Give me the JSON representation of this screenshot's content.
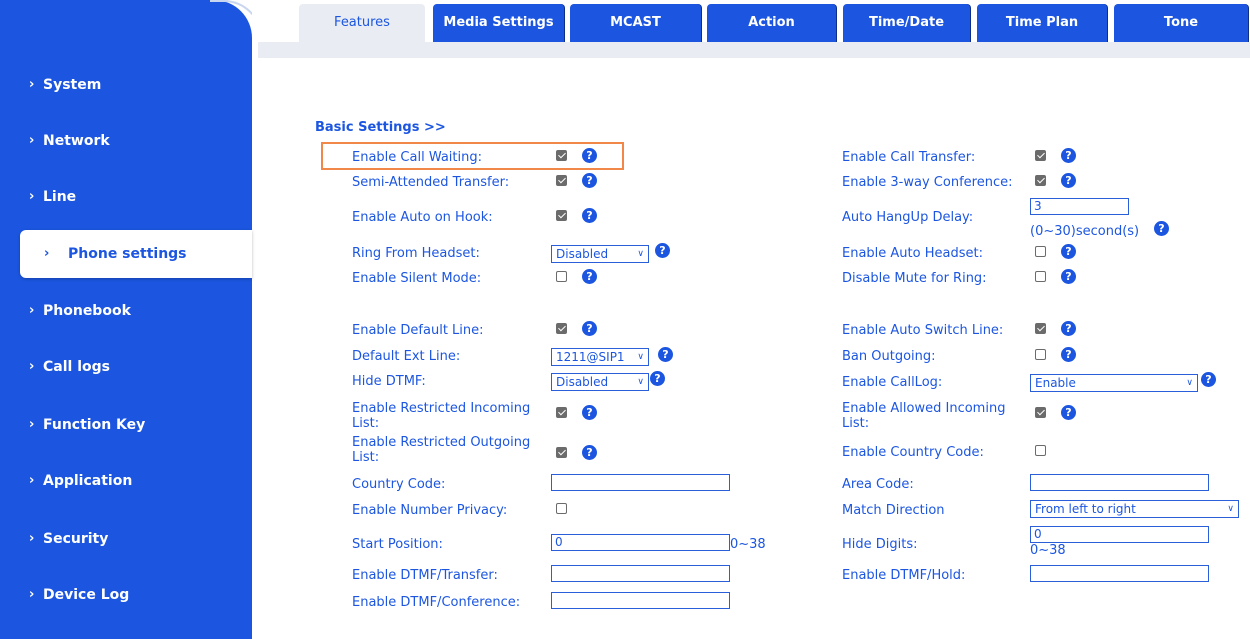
{
  "tabs": [
    {
      "label": "Features"
    },
    {
      "label": "Media Settings"
    },
    {
      "label": "MCAST"
    },
    {
      "label": "Action"
    },
    {
      "label": "Time/Date"
    },
    {
      "label": "Time Plan"
    },
    {
      "label": "Tone"
    }
  ],
  "sidebar": {
    "chevron": "›",
    "items": [
      {
        "label": "System"
      },
      {
        "label": "Network"
      },
      {
        "label": "Line"
      },
      {
        "label": "Phone settings"
      },
      {
        "label": "Phonebook"
      },
      {
        "label": "Call logs"
      },
      {
        "label": "Function Key"
      },
      {
        "label": "Application"
      },
      {
        "label": "Security"
      },
      {
        "label": "Device Log"
      }
    ]
  },
  "section": {
    "title": "Basic Settings >>"
  },
  "help_glyph": "?",
  "arrow_glyph": "∨",
  "left": {
    "call_waiting": {
      "label": "Enable Call Waiting:",
      "checked": true
    },
    "semi_transfer": {
      "label": "Semi-Attended Transfer:",
      "checked": true
    },
    "auto_on_hook": {
      "label": "Enable Auto on Hook:",
      "checked": true
    },
    "ring_headset": {
      "label": "Ring From Headset:",
      "value": "Disabled"
    },
    "silent_mode": {
      "label": "Enable Silent Mode:",
      "checked": false
    },
    "default_line": {
      "label": "Enable Default Line:",
      "checked": true
    },
    "default_ext": {
      "label": "Default Ext Line:",
      "value": "1211@SIP1"
    },
    "hide_dtmf": {
      "label": "Hide DTMF:",
      "value": "Disabled"
    },
    "restricted_in": {
      "label_line1": "Enable Restricted Incoming",
      "label_line2": "List:",
      "checked": true
    },
    "restricted_out": {
      "label_line1": "Enable Restricted Outgoing",
      "label_line2": "List:",
      "checked": true
    },
    "country_code": {
      "label": "Country Code:",
      "value": ""
    },
    "number_privacy": {
      "label": "Enable Number Privacy:",
      "checked": false
    },
    "start_position": {
      "label": "Start Position:",
      "value": "0",
      "range": "0~38"
    },
    "dtmf_transfer": {
      "label": "Enable DTMF/Transfer:",
      "value": ""
    },
    "dtmf_conference": {
      "label": "Enable DTMF/Conference:",
      "value": ""
    }
  },
  "right": {
    "call_transfer": {
      "label": "Enable Call Transfer:",
      "checked": true
    },
    "three_way": {
      "label": "Enable 3-way Conference:",
      "checked": true
    },
    "hangup_delay": {
      "label": "Auto HangUp Delay:",
      "value": "3",
      "unit": "(0~30)second(s)"
    },
    "auto_headset": {
      "label": "Enable Auto Headset:",
      "checked": false
    },
    "mute_ring": {
      "label": "Disable Mute for Ring:",
      "checked": false
    },
    "auto_switch": {
      "label": "Enable Auto Switch Line:",
      "checked": true
    },
    "ban_outgoing": {
      "label": "Ban Outgoing:",
      "checked": false
    },
    "calllog": {
      "label": "Enable CallLog:",
      "value": "Enable"
    },
    "allowed_in": {
      "label_line1": "Enable Allowed Incoming",
      "label_line2": "List:",
      "checked": true
    },
    "country_code_en": {
      "label": "Enable Country Code:",
      "checked": false
    },
    "area_code": {
      "label": "Area Code:",
      "value": ""
    },
    "match_direction": {
      "label": "Match Direction",
      "value": "From left to right"
    },
    "hide_digits": {
      "label": "Hide Digits:",
      "value": "0",
      "range": "0~38"
    },
    "dtmf_hold": {
      "label": "Enable DTMF/Hold:",
      "value": ""
    }
  },
  "colors": {
    "primary": "#1c56e0",
    "highlight": "#f1884a",
    "band": "#e9ecf2"
  }
}
